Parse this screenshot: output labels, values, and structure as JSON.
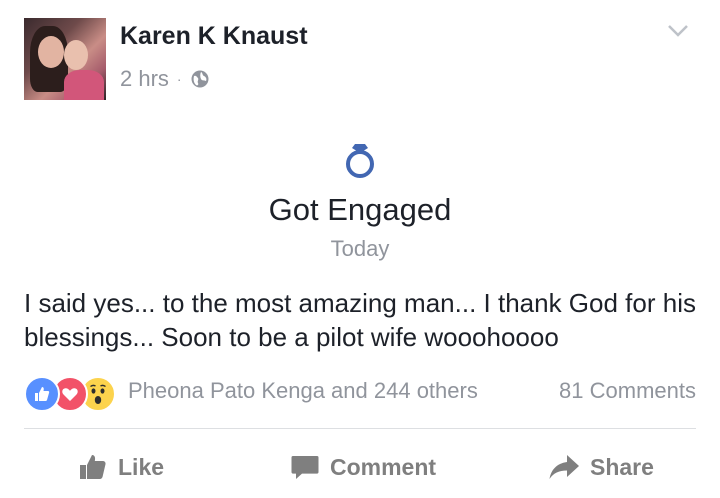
{
  "post": {
    "author": "Karen K Knaust",
    "time": "2 hrs",
    "separator": "·",
    "privacy_icon": "globe-icon",
    "menu_icon": "chevron-down-icon"
  },
  "life_event": {
    "icon": "ring-icon",
    "title": "Got Engaged",
    "date": "Today"
  },
  "body_text": "I said yes... to the most amazing man... I thank God for his blessings... Soon to be a pilot wife wooohoooo",
  "reactions": {
    "icons": [
      "like-reaction-icon",
      "love-reaction-icon",
      "wow-reaction-icon"
    ],
    "summary": "Pheona Pato Kenga and 244 others",
    "comments": "81 Comments"
  },
  "actions": {
    "like": "Like",
    "comment": "Comment",
    "share": "Share"
  },
  "colors": {
    "text": "#1d2129",
    "muted": "#90949c",
    "ring": "#4267b2",
    "like": "#5890ff",
    "love": "#f25268",
    "wow": "#fcd34d"
  }
}
